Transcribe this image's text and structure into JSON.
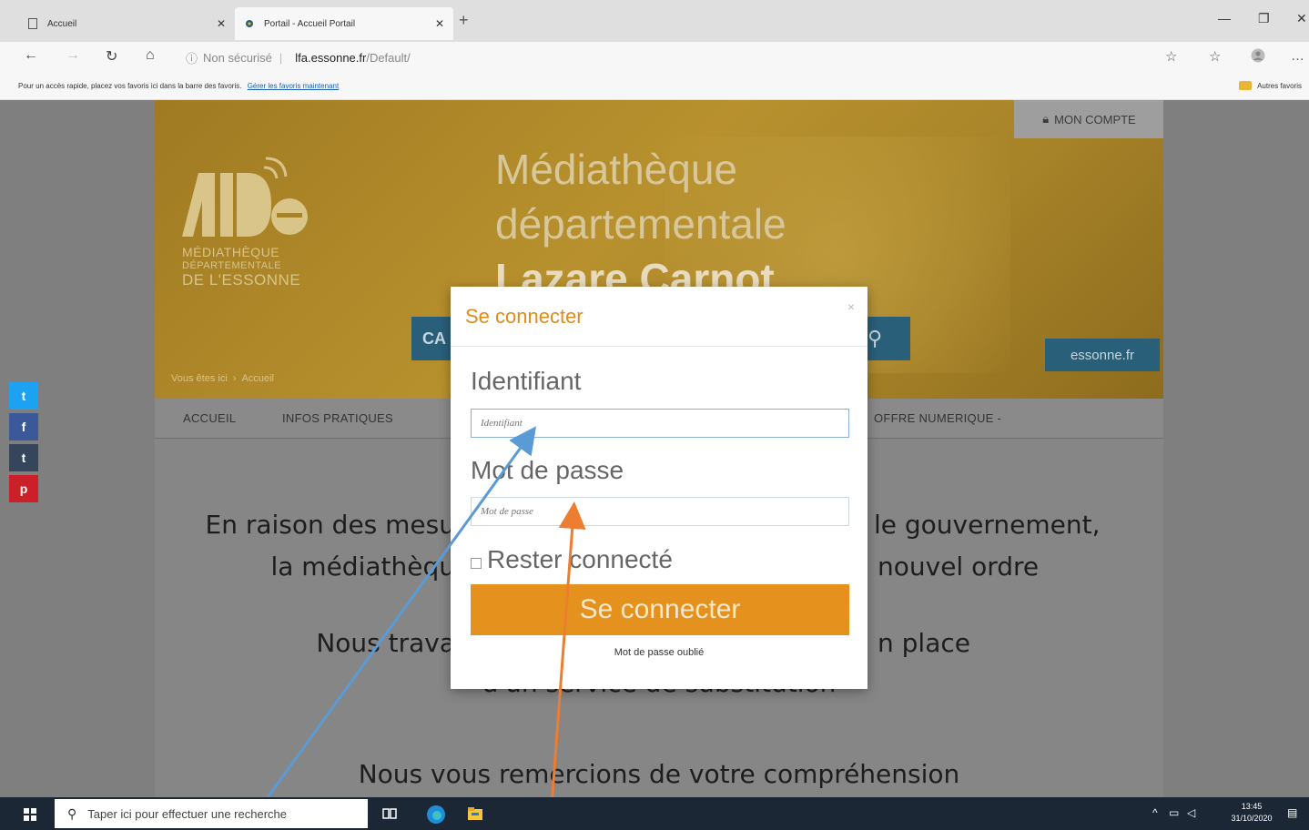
{
  "browser": {
    "tabs": [
      {
        "label": "Accueil",
        "active": false
      },
      {
        "label": "Portail - Accueil Portail",
        "active": true
      }
    ],
    "address": {
      "security": "Non sécurisé",
      "host": "lfa.essonne.fr",
      "path": "/Default/"
    },
    "favorites_bar": {
      "message": "Pour un accès rapide, placez vos favoris ici dans la barre des favoris.",
      "link": "Gérer les favoris maintenant",
      "other": "Autres favoris"
    }
  },
  "site": {
    "logo": {
      "line1": "MÉDIATHÈQUE",
      "line2": "DÉPARTEMENTALE",
      "line3": "DE L'ESSONNE"
    },
    "banner_title": {
      "line1": "Médiathèque",
      "line2": "départementale",
      "line3": "Lazare Carnot"
    },
    "mon_compte": "MON COMPTE",
    "catalogue_btn": "CA",
    "essonne_btn": "essonne.fr",
    "breadcrumb": {
      "prefix": "Vous êtes ici",
      "current": "Accueil"
    },
    "menu": [
      "ACCUEIL",
      "INFOS PRATIQUES",
      "OFFRE NUMERIQUE -"
    ],
    "content_lines": [
      "En raison des mesu",
      "le gouvernement,",
      "la médiathèqu",
      "nouvel ordre",
      "Nous trava",
      "n place",
      "d'un service de substitution",
      "Nous vous remercions de votre compréhension"
    ]
  },
  "modal": {
    "title": "Se connecter",
    "close": "×",
    "username_label": "Identifiant",
    "username_placeholder": "Identifiant",
    "password_label": "Mot de passe",
    "password_placeholder": "Mot de passe",
    "remember_label": "Rester connecté",
    "submit_label": "Se connecter",
    "forgot_label": "Mot de passe oublié"
  },
  "taskbar": {
    "search_placeholder": "Taper ici pour effectuer une recherche",
    "time": "13:45",
    "date": "31/10/2020"
  },
  "colors": {
    "accent_orange": "#e4921d",
    "annotation_blue": "#5b9bd5",
    "annotation_orange": "#ed7d31",
    "taskbar": "#1b2734"
  }
}
